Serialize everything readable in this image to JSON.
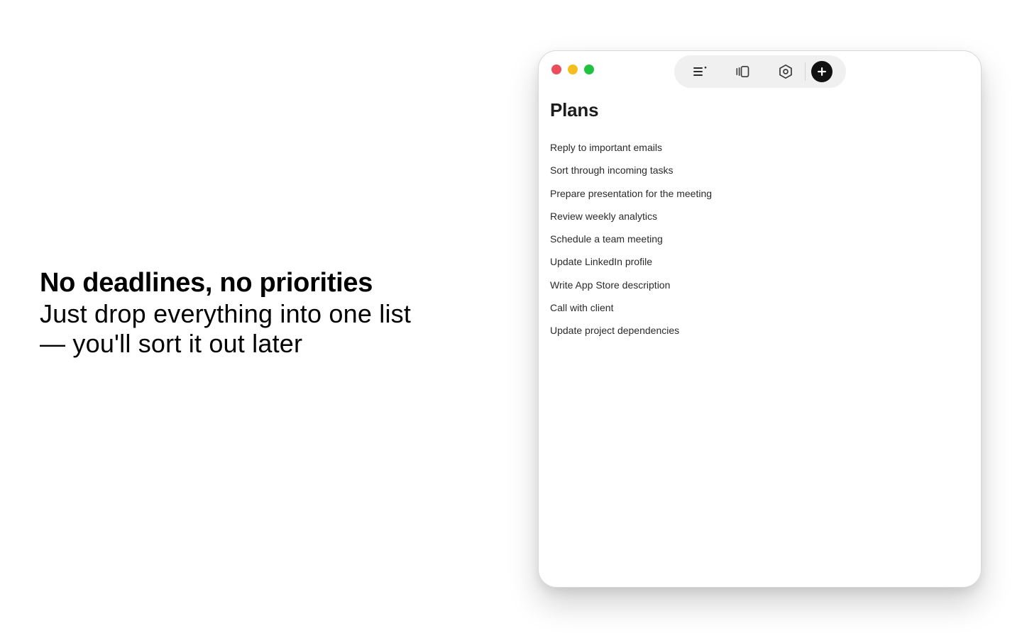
{
  "promo": {
    "headline": "No deadlines, no priorities",
    "subline_1": "Just drop everything into one list",
    "subline_2": "— you'll sort it out later"
  },
  "window": {
    "controls": {
      "close_color": "#ec4d5b",
      "minimize_color": "#f5be1c",
      "maximize_color": "#22c241"
    },
    "toolbar": {
      "buttons": [
        {
          "icon": "list-icon"
        },
        {
          "icon": "cards-icon"
        },
        {
          "icon": "settings-hexagon-icon"
        },
        {
          "icon": "plus-icon"
        }
      ]
    },
    "list": {
      "title": "Plans",
      "tasks": [
        "Reply to important emails",
        "Sort through incoming tasks",
        "Prepare presentation for the meeting",
        "Review weekly analytics",
        "Schedule a team meeting",
        "Update LinkedIn profile",
        "Write App Store description",
        "Call with client",
        "Update project dependencies"
      ]
    }
  }
}
